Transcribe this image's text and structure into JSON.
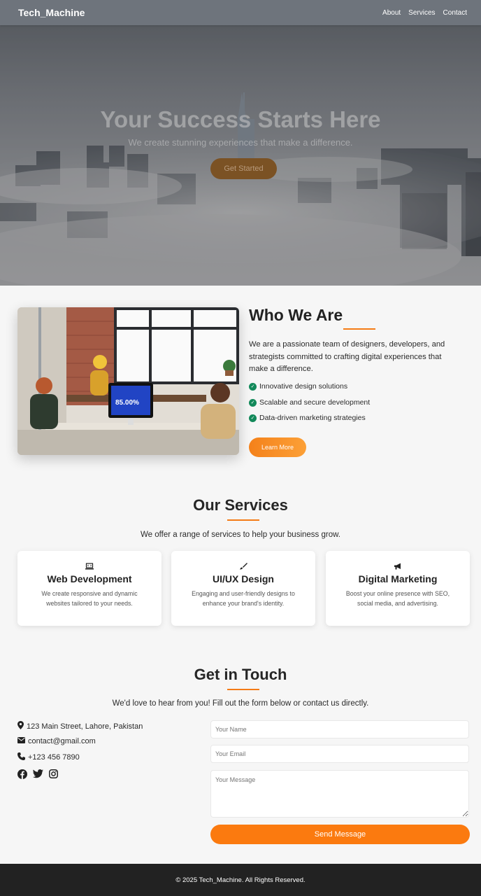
{
  "nav": {
    "brand": "Tech_Machine",
    "links": [
      "About",
      "Services",
      "Contact"
    ]
  },
  "hero": {
    "title": "Your Success Starts Here",
    "subtitle": "We create stunning experiences that make a difference.",
    "cta": "Get Started"
  },
  "about": {
    "title": "Who We Are",
    "text": "We are a passionate team of designers, developers, and strategists committed to crafting digital experiences that make a difference.",
    "features": [
      "Innovative design solutions",
      "Scalable and secure development",
      "Data-driven marketing strategies"
    ],
    "cta": "Learn More",
    "screen_text": "85.00%"
  },
  "services": {
    "title": "Our Services",
    "subtitle": "We offer a range of services to help your business grow.",
    "cards": [
      {
        "icon": "laptop-code-icon",
        "title": "Web Development",
        "text": "We create responsive and dynamic websites tailored to your needs."
      },
      {
        "icon": "paint-brush-icon",
        "title": "UI/UX Design",
        "text": "Engaging and user-friendly designs to enhance your brand's identity."
      },
      {
        "icon": "bullhorn-icon",
        "title": "Digital Marketing",
        "text": "Boost your online presence with SEO, social media, and advertising."
      }
    ]
  },
  "contact": {
    "title": "Get in Touch",
    "subtitle": "We'd love to hear from you! Fill out the form below or contact us directly.",
    "address": "123 Main Street, Lahore, Pakistan",
    "email": "contact@gmail.com",
    "phone": "+123 456 7890",
    "form": {
      "name_placeholder": "Your Name",
      "email_placeholder": "Your Email",
      "message_placeholder": "Your Message",
      "submit": "Send Message"
    }
  },
  "footer": {
    "text": "© 2025 Tech_Machine. All Rights Reserved."
  },
  "colors": {
    "accent": "#f47b16",
    "check": "#12895a",
    "footer_bg": "#222222"
  }
}
